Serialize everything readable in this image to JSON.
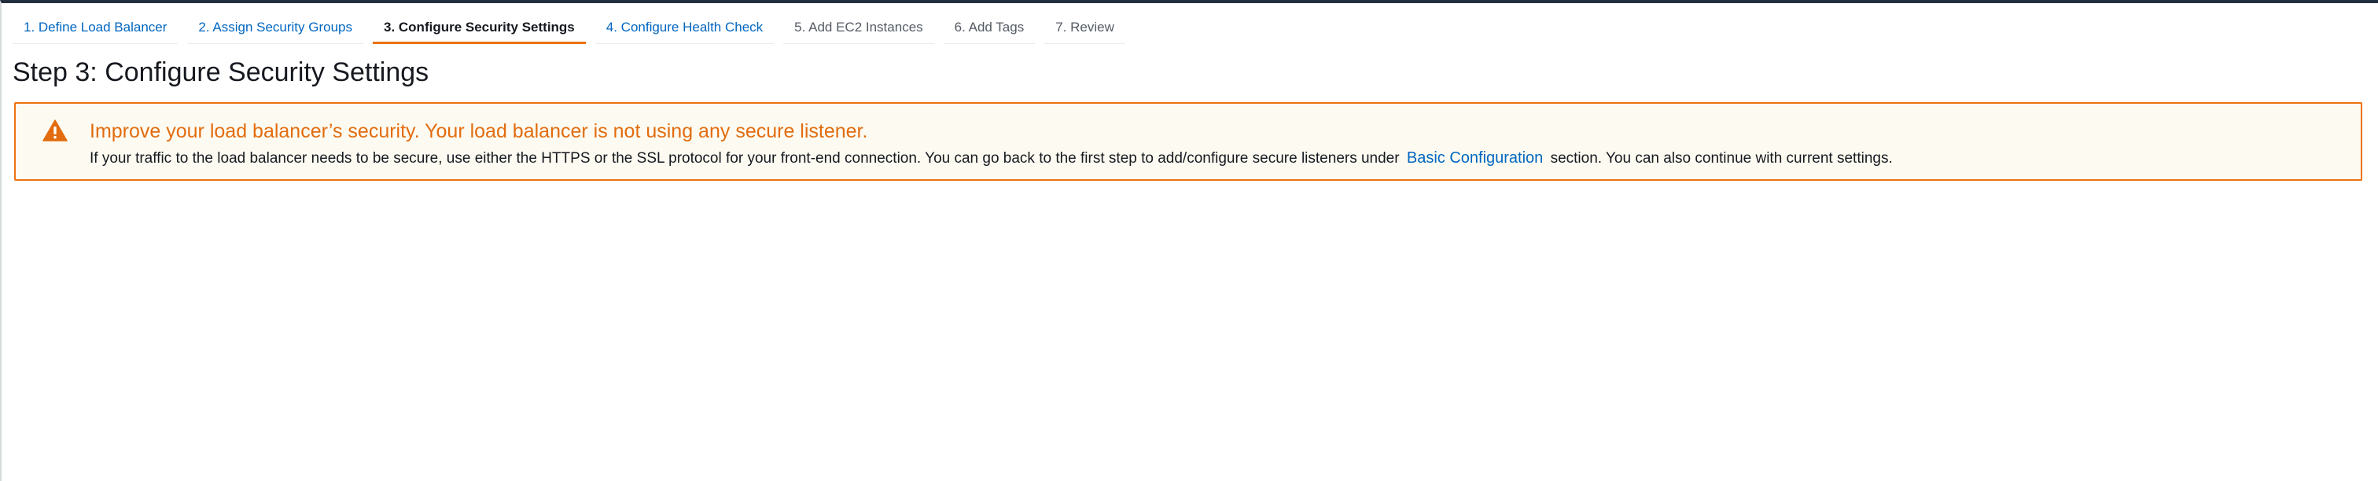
{
  "wizard": {
    "steps": [
      {
        "label": "1. Define Load Balancer",
        "state": "done"
      },
      {
        "label": "2. Assign Security Groups",
        "state": "done"
      },
      {
        "label": "3. Configure Security Settings",
        "state": "active"
      },
      {
        "label": "4. Configure Health Check",
        "state": "link"
      },
      {
        "label": "5. Add EC2 Instances",
        "state": "future"
      },
      {
        "label": "6. Add Tags",
        "state": "future"
      },
      {
        "label": "7. Review",
        "state": "future"
      }
    ]
  },
  "page": {
    "title": "Step 3: Configure Security Settings"
  },
  "alert": {
    "icon": "warning-icon",
    "heading": "Improve your load balancer’s security. Your load balancer is not using any secure listener.",
    "body_before": "If your traffic to the load balancer needs to be secure, use either the HTTPS or the SSL protocol for your front-end connection. You can go back to the first step to add/configure secure listeners under ",
    "link_text": "Basic Configuration",
    "body_after": " section. You can also continue with current settings."
  },
  "colors": {
    "accent": "#ec7211",
    "warning_text": "#e26c0f",
    "link": "#0066c0",
    "alert_background": "#fdfbf1"
  }
}
